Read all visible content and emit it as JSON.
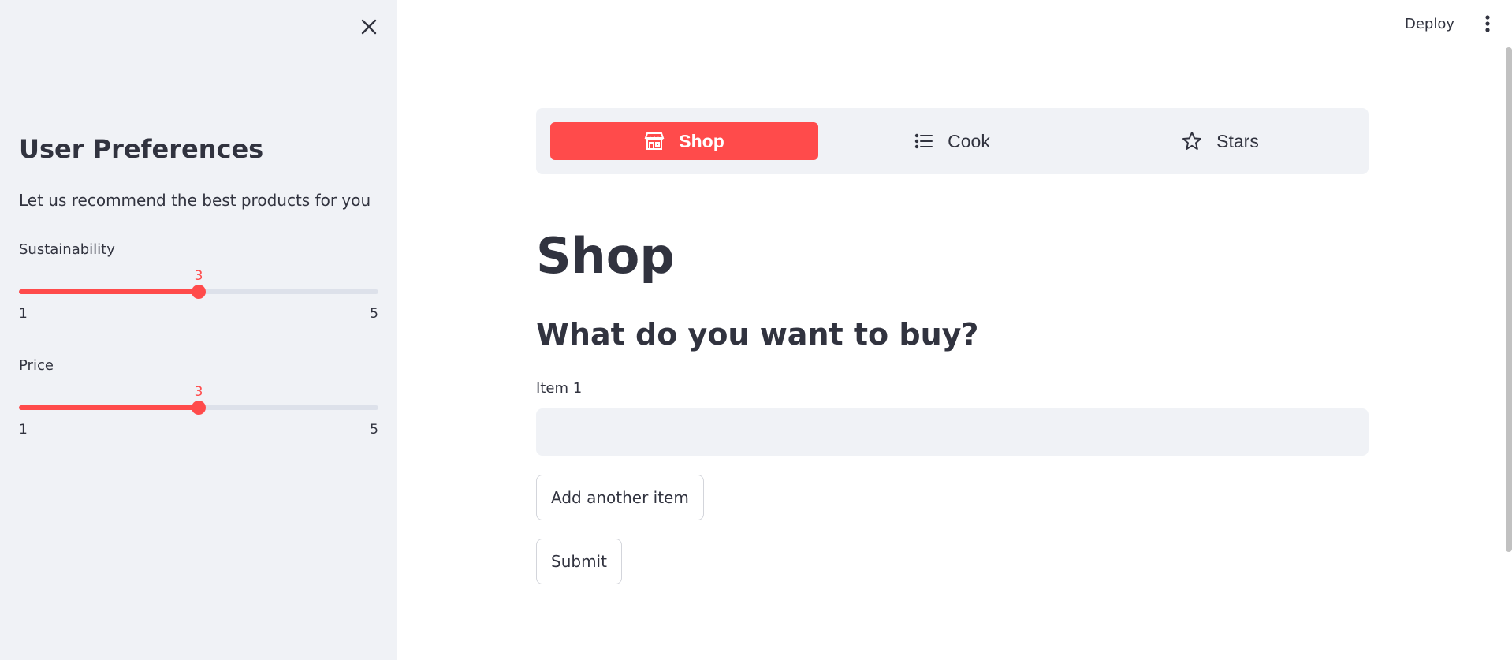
{
  "sidebar": {
    "title": "User Preferences",
    "description": "Let us recommend the best products for you",
    "close_icon": "close-icon",
    "sliders": [
      {
        "label": "Sustainability",
        "value": 3,
        "min": 1,
        "max": 5
      },
      {
        "label": "Price",
        "value": 3,
        "min": 1,
        "max": 5
      }
    ]
  },
  "topbar": {
    "deploy_label": "Deploy",
    "menu_icon": "kebab-menu-icon"
  },
  "nav": {
    "items": [
      {
        "label": "Shop",
        "icon": "shop-icon",
        "active": true
      },
      {
        "label": "Cook",
        "icon": "list-icon",
        "active": false
      },
      {
        "label": "Stars",
        "icon": "star-icon",
        "active": false
      }
    ]
  },
  "main": {
    "title": "Shop",
    "subtitle": "What do you want to buy?",
    "item_label": "Item 1",
    "item_value": "",
    "add_button": "Add another item",
    "submit_button": "Submit"
  },
  "colors": {
    "accent": "#ff4b4b",
    "sidebar_bg": "#f0f2f6",
    "text": "#31333f"
  }
}
